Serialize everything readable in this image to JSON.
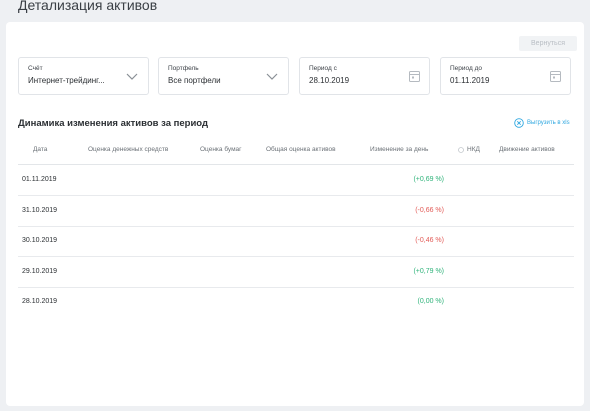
{
  "page_title": "Детализация активов",
  "return_label": "Вернуться",
  "filters": [
    {
      "label": "Счёт",
      "value": "Интернет-трейдинг...",
      "control": "dropdown"
    },
    {
      "label": "Портфель",
      "value": "Все портфели",
      "control": "dropdown"
    },
    {
      "label": "Период с",
      "value": "28.10.2019",
      "control": "date"
    },
    {
      "label": "Период до",
      "value": "01.11.2019",
      "control": "date"
    }
  ],
  "section_title": "Динамика изменения активов за период",
  "export_label": "Выгрузить в xls",
  "columns": [
    "Дата",
    "Оценка денежных средств",
    "Оценка бумаг",
    "Общая оценка активов",
    "Изменение за день",
    "НКД",
    "Движение активов"
  ],
  "rows": [
    {
      "date": "01.11.2019",
      "change": "(+0,69 %)",
      "trend": "positive"
    },
    {
      "date": "31.10.2019",
      "change": "(-0,66 %)",
      "trend": "negative"
    },
    {
      "date": "30.10.2019",
      "change": "(-0,46 %)",
      "trend": "negative"
    },
    {
      "date": "29.10.2019",
      "change": "(+0,79 %)",
      "trend": "positive"
    },
    {
      "date": "28.10.2019",
      "change": "(0,00 %)",
      "trend": "zero"
    }
  ],
  "colors": {
    "positive": "#2fb37a",
    "negative": "#e25b57",
    "accent": "#2ea7e0"
  },
  "icons": {
    "dropdown": "chevron-down-icon",
    "date": "calendar-icon",
    "export": "excel-icon"
  }
}
